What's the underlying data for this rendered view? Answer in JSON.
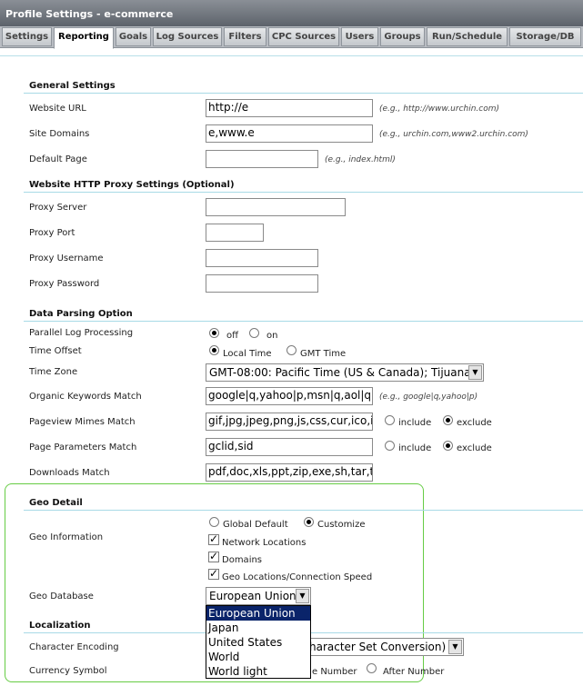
{
  "window": {
    "title": "Profile Settings - e-commerce"
  },
  "tabs": [
    {
      "label": "Settings"
    },
    {
      "label": "Reporting"
    },
    {
      "label": "Goals"
    },
    {
      "label": "Log Sources"
    },
    {
      "label": "Filters"
    },
    {
      "label": "CPC Sources"
    },
    {
      "label": "Users"
    },
    {
      "label": "Groups"
    },
    {
      "label": "Run/Schedule"
    },
    {
      "label": "Storage/DB"
    }
  ],
  "general": {
    "heading": "General Settings",
    "website_url": {
      "label": "Website URL",
      "value": "http://e",
      "hint": "(e.g., http://www.urchin.com)"
    },
    "site_domains": {
      "label": "Site Domains",
      "value": "e,www.e",
      "hint": "(e.g., urchin.com,www2.urchin.com)"
    },
    "default_page": {
      "label": "Default Page",
      "value": "",
      "hint": "(e.g., index.html)"
    }
  },
  "proxy": {
    "heading": "Website HTTP Proxy Settings (Optional)",
    "server": {
      "label": "Proxy Server",
      "value": ""
    },
    "port": {
      "label": "Proxy Port",
      "value": ""
    },
    "username": {
      "label": "Proxy Username",
      "value": ""
    },
    "password": {
      "label": "Proxy Password",
      "value": ""
    }
  },
  "parsing": {
    "heading": "Data Parsing Option",
    "parallel": {
      "label": "Parallel Log Processing",
      "opt1": "off",
      "opt2": "on"
    },
    "offset": {
      "label": "Time Offset",
      "opt1": "Local Time",
      "opt2": "GMT Time"
    },
    "timezone": {
      "label": "Time Zone",
      "value": "GMT-08:00: Pacific Time (US & Canada); Tijuana"
    },
    "organic": {
      "label": "Organic Keywords Match",
      "value": "google|q,yahoo|p,msn|q,aol|que",
      "hint": "(e.g., google|q,yahoo|p)"
    },
    "mimes": {
      "label": "Pageview Mimes Match",
      "value": "gif,jpg,jpeg,png,js,css,cur,ico,ic",
      "opt1": "include",
      "opt2": "exclude"
    },
    "params": {
      "label": "Page Parameters Match",
      "value": "gclid,sid",
      "opt1": "include",
      "opt2": "exclude"
    },
    "downloads": {
      "label": "Downloads Match",
      "value": "pdf,doc,xls,ppt,zip,exe,sh,tar,tg"
    }
  },
  "geo": {
    "heading": "Geo Detail",
    "info_label": "Geo Information",
    "opt_global": "Global Default",
    "opt_custom": "Customize",
    "chk_network": "Network Locations",
    "chk_domains": "Domains",
    "chk_geo": "Geo Locations/Connection Speed",
    "db_label": "Geo Database",
    "db_value": "European Union",
    "db_options": [
      "European Union",
      "Japan",
      "United States",
      "World",
      "World light"
    ]
  },
  "localization": {
    "heading": "Localization",
    "encoding_label": "Character Encoding",
    "encoding_value": "haracter Set Conversion)",
    "currency_label": "Currency Symbol",
    "currency_opt1": "e Number",
    "currency_opt2": "After Number"
  }
}
